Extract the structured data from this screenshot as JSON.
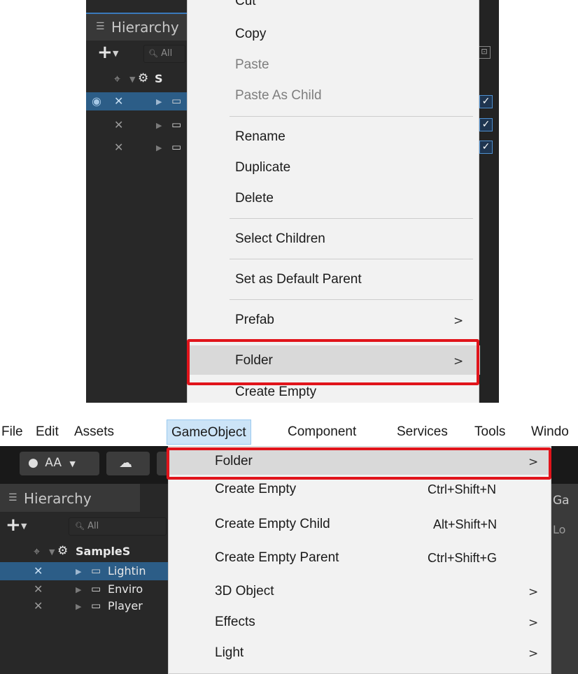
{
  "top_panel": {
    "hierarchy_title": "Hierarchy",
    "search_placeholder": "All",
    "scene_label": "S",
    "context_menu": {
      "items": [
        {
          "label": "Cut",
          "disabled": false
        },
        {
          "label": "Copy",
          "disabled": false
        },
        {
          "label": "Paste",
          "disabled": true
        },
        {
          "label": "Paste As Child",
          "disabled": true
        },
        {
          "label": "Rename",
          "disabled": false
        },
        {
          "label": "Duplicate",
          "disabled": false
        },
        {
          "label": "Delete",
          "disabled": false
        },
        {
          "label": "Select Children",
          "disabled": false
        },
        {
          "label": "Set as Default Parent",
          "disabled": false
        },
        {
          "label": "Prefab",
          "submenu": true
        },
        {
          "label": "Folder",
          "submenu": true,
          "highlighted": true
        },
        {
          "label": "Create Empty",
          "disabled": false
        }
      ],
      "submenu_arrow": ">"
    }
  },
  "menubar": {
    "items": [
      "File",
      "Edit",
      "Assets",
      "GameObject",
      "Component",
      "Services",
      "Tools",
      "Windo"
    ],
    "active": "GameObject"
  },
  "toolbar": {
    "account_label": "AA",
    "account_icon": "user-icon",
    "cloud_icon": "cloud-icon"
  },
  "hierarchy": {
    "title": "Hierarchy",
    "search_placeholder": "All",
    "scene_name": "SampleS",
    "rows": [
      {
        "label": "Lightin",
        "selected": true
      },
      {
        "label": "Enviro",
        "selected": false
      },
      {
        "label": "Player",
        "selected": false
      }
    ]
  },
  "scene_view": {
    "tab_label": "Ga",
    "field_label": "Lo"
  },
  "gameobject_menu": {
    "items": [
      {
        "label": "Folder",
        "shortcut": "",
        "submenu": true,
        "highlighted": true
      },
      {
        "label": "Create Empty",
        "shortcut": "Ctrl+Shift+N",
        "submenu": false
      },
      {
        "label": "Create Empty Child",
        "shortcut": "Alt+Shift+N",
        "submenu": false
      },
      {
        "label": "Create Empty Parent",
        "shortcut": "Ctrl+Shift+G",
        "submenu": false
      },
      {
        "label": "3D Object",
        "shortcut": "",
        "submenu": true
      },
      {
        "label": "Effects",
        "shortcut": "",
        "submenu": true
      },
      {
        "label": "Light",
        "shortcut": "",
        "submenu": true
      }
    ],
    "submenu_arrow": ">"
  },
  "colors": {
    "highlight_border": "#e1141b",
    "selection": "#2c5d87",
    "menu_bg": "#f2f2f2"
  }
}
